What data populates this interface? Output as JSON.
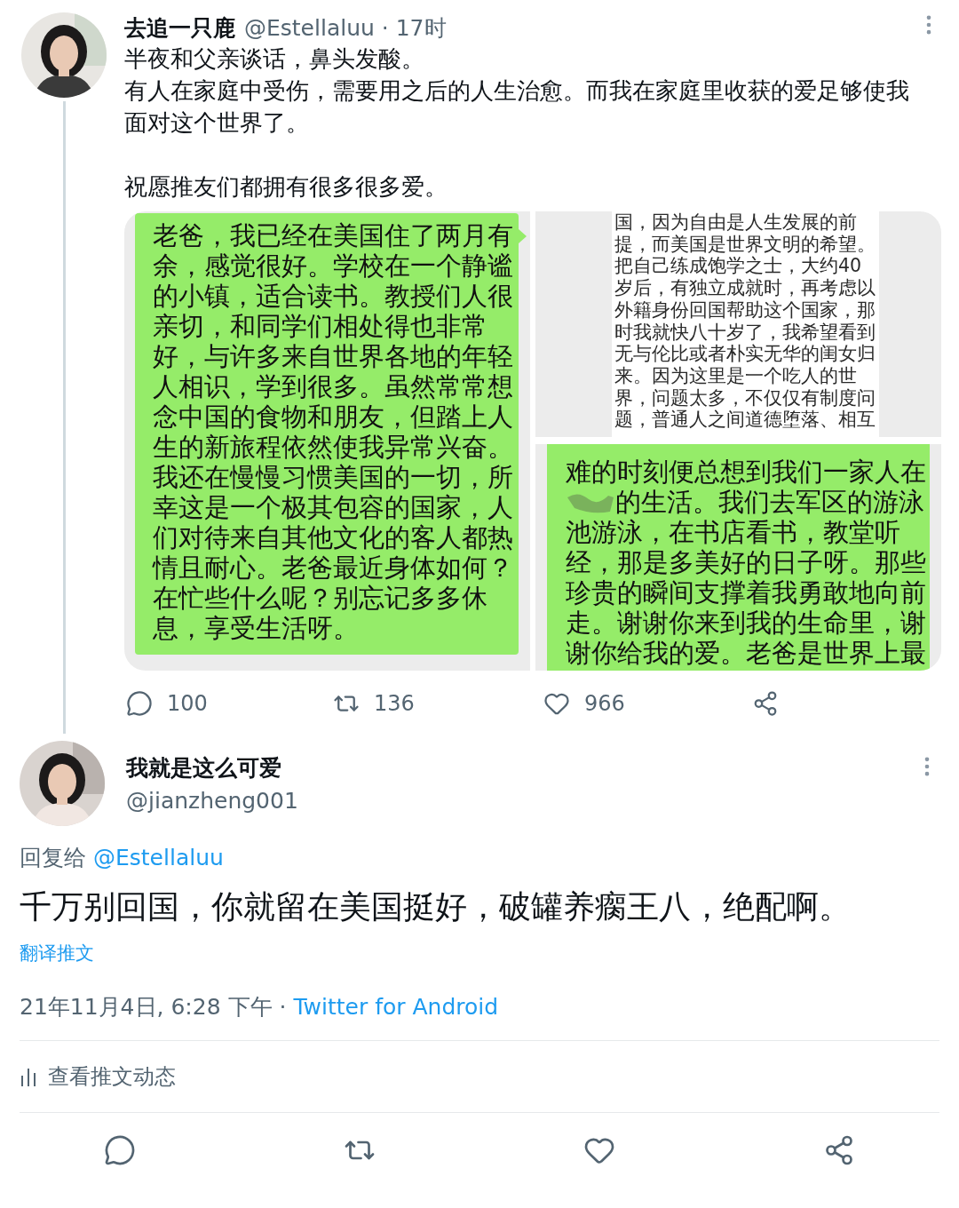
{
  "tweet": {
    "author": {
      "name": "去追一只鹿",
      "meta": "@Estellaluu · 17时"
    },
    "text": [
      [
        "半夜和父亲谈话，鼻头发酸。",
        "有人在家庭中受伤，需要用之后的人生治愈。而我在家庭里收获的爱足够使我面对这个世界了。"
      ],
      [
        "祝愿推友们都拥有很多很多爱。"
      ]
    ],
    "media": [
      {
        "kind": "bubble",
        "lines": [
          "老爸，我已经在美国住了两月有",
          "余，感觉很好。学校在一个静谧",
          "的小镇，适合读书。教授们人很",
          "亲切，和同学们相处得也非常",
          "好，与许多来自世界各地的年轻",
          "人相识，学到很多。虽然常常想",
          "念中国的食物和朋友，但踏上人",
          "生的新旅程依然使我异常兴奋。",
          "我还在慢慢习惯美国的一切，所",
          "幸这是一个极其包容的国家，人",
          "们对待来自其他文化的客人都热",
          "情且耐心。老爸最近身体如何？",
          "在忙些什么呢？别忘记多多休",
          "息，享受生活呀。"
        ]
      },
      {
        "kind": "note",
        "lines": [
          "国，因为自由是人生发展的前",
          "提，而美国是世界文明的希望。",
          "把自己练成饱学之士，大约40",
          "岁后，有独立成就时，再考虑以",
          "外籍身份回国帮助这个国家，那",
          "时我就快八十岁了，我希望看到",
          "无与伦比或者朴实无华的闺女归",
          "来。因为这里是一个吃人的世",
          "界，问题太多，不仅仅有制度问",
          "题，普通人之间道德堕落、相互"
        ]
      },
      {
        "kind": "cut-bubble",
        "lines": [
          {
            "text": "难的时刻便总想到我们一家人在",
            "redacted": false
          },
          {
            "text": "的生活。我们去军区的游泳",
            "redacted": true
          },
          {
            "text": "池游泳，在书店看书，教堂听",
            "redacted": false
          },
          {
            "text": "经，那是多美好的日子呀。那些",
            "redacted": false
          },
          {
            "text": "珍贵的瞬间支撑着我勇敢地向前",
            "redacted": false
          },
          {
            "text": "走。谢谢你来到我的生命里，谢",
            "redacted": false
          },
          {
            "text": "谢你给我的爱。老爸是世界上最",
            "redacted": false
          }
        ]
      }
    ],
    "actions": [
      {
        "kind": "reply",
        "count": "100"
      },
      {
        "kind": "retweet",
        "count": "136"
      },
      {
        "kind": "like",
        "count": "966"
      },
      {
        "kind": "share"
      }
    ]
  },
  "reply": {
    "author": {
      "name": "我就是这么可爱",
      "handle": "@jianzheng001"
    },
    "replying_to": {
      "label": "回复给",
      "mention": "@Estellaluu"
    },
    "text": "千万别回国，你就留在美国挺好，破罐养瘸王八，绝配啊。",
    "translate": "翻译推文",
    "timestamp": "21年11月4日, 6:28 下午 ·",
    "source": "Twitter for Android",
    "activity": "查看推文动态",
    "actions": [
      {
        "kind": "reply"
      },
      {
        "kind": "retweet"
      },
      {
        "kind": "like"
      },
      {
        "kind": "share"
      }
    ]
  }
}
